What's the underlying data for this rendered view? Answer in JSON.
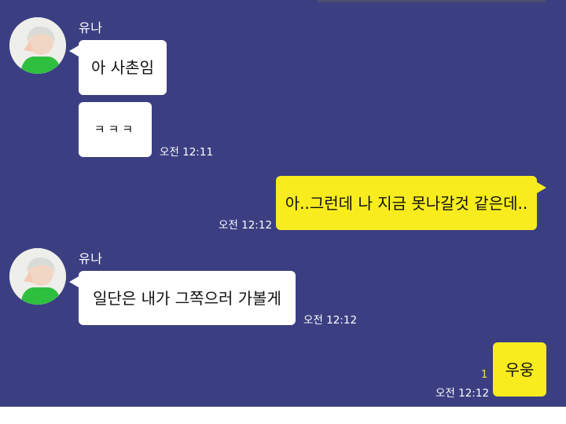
{
  "messages": [
    {
      "sender": "유나",
      "text": "아 사촌임"
    },
    {
      "text": "ㅋㅋㅋ",
      "time": "오전 12:11"
    },
    {
      "text": "아..그런데 나 지금 못나갈것 같은데..",
      "time": "오전 12:12"
    },
    {
      "sender": "유나",
      "text": "일단은 내가 그쪽으러 가볼게",
      "time": "오전 12:12"
    },
    {
      "text": "우웅",
      "time": "오전 12:12",
      "unread": "1"
    }
  ],
  "colors": {
    "background": "#3b3f82",
    "incoming_bubble": "#ffffff",
    "outgoing_bubble": "#f8ec1f",
    "unread_count": "#f5e742"
  },
  "icons": {
    "avatar": "profile-photo-avatar"
  }
}
